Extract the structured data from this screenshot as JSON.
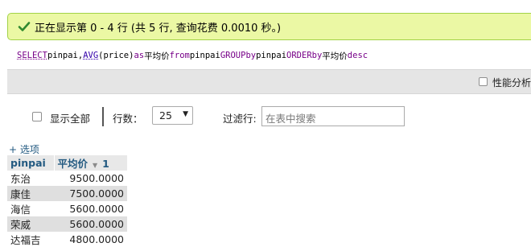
{
  "message": {
    "text": "正在显示第 0 - 4 行 (共 5 行, 查询花费 0.0010 秒。)",
    "accent": "#ebf8a4"
  },
  "sql": {
    "t1": "SELECT",
    "t2": " pinpai,",
    "t3": "AVG",
    "t4": "(price) ",
    "t5": "as",
    "t6": " 平均价 ",
    "t7": "from",
    "t8": " pinpai ",
    "t9": "GROUP",
    "t10": " ",
    "t11": "by",
    "t12": " pinpai ",
    "t13": "ORDER",
    "t14": " ",
    "t15": "by",
    "t16": " 平均价 ",
    "t17": "desc"
  },
  "profiling": {
    "label": "性能分析"
  },
  "nav": {
    "show_all": "显示全部",
    "rows_label": "行数：",
    "rows_value": "25",
    "filter_label": "过滤行:",
    "filter_placeholder": "在表中搜索"
  },
  "options": {
    "label": "+ 选项"
  },
  "table": {
    "columns": [
      "pinpai",
      "平均价"
    ],
    "sort_rank": "1",
    "rows": [
      [
        "东治",
        "9500.0000"
      ],
      [
        "康佳",
        "7500.0000"
      ],
      [
        "海信",
        "5600.0000"
      ],
      [
        "荣威",
        "5600.0000"
      ],
      [
        "达福吉",
        "4800.0000"
      ]
    ]
  }
}
